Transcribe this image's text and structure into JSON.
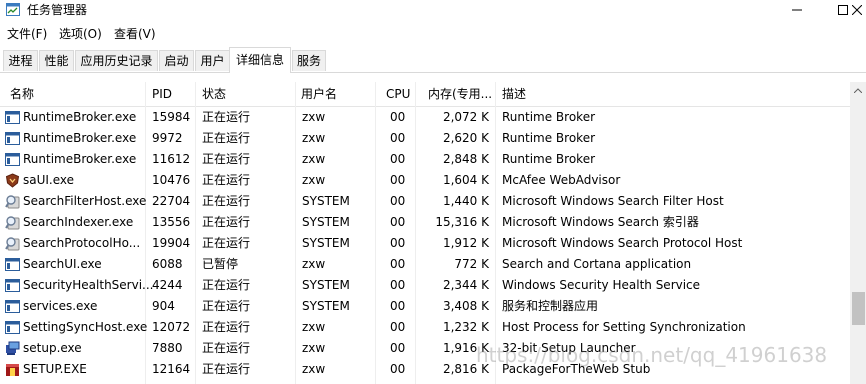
{
  "window": {
    "title": "任务管理器"
  },
  "menu": [
    "文件(F)",
    "选项(O)",
    "查看(V)"
  ],
  "tabs": [
    "进程",
    "性能",
    "应用历史记录",
    "启动",
    "用户",
    "详细信息",
    "服务"
  ],
  "active_tab": "详细信息",
  "columns": {
    "name": "名称",
    "pid": "PID",
    "status": "状态",
    "user": "用户名",
    "cpu": "CPU",
    "mem": "内存(专用...",
    "desc": "描述"
  },
  "rows": [
    {
      "icon": "window-app-icon",
      "name": "RuntimeBroker.exe",
      "pid": "15984",
      "status": "正在运行",
      "user": "zxw",
      "cpu": "00",
      "mem": "2,072 K",
      "desc": "Runtime Broker"
    },
    {
      "icon": "window-app-icon",
      "name": "RuntimeBroker.exe",
      "pid": "9972",
      "status": "正在运行",
      "user": "zxw",
      "cpu": "00",
      "mem": "2,620 K",
      "desc": "Runtime Broker"
    },
    {
      "icon": "window-app-icon",
      "name": "RuntimeBroker.exe",
      "pid": "11612",
      "status": "正在运行",
      "user": "zxw",
      "cpu": "00",
      "mem": "2,848 K",
      "desc": "Runtime Broker"
    },
    {
      "icon": "mcafee-shield-icon",
      "name": "saUI.exe",
      "pid": "10476",
      "status": "正在运行",
      "user": "zxw",
      "cpu": "00",
      "mem": "1,604 K",
      "desc": "McAfee WebAdvisor"
    },
    {
      "icon": "search-indexer-icon",
      "name": "SearchFilterHost.exe",
      "pid": "22704",
      "status": "正在运行",
      "user": "SYSTEM",
      "cpu": "00",
      "mem": "1,440 K",
      "desc": "Microsoft Windows Search Filter Host"
    },
    {
      "icon": "search-indexer-icon",
      "name": "SearchIndexer.exe",
      "pid": "13556",
      "status": "正在运行",
      "user": "SYSTEM",
      "cpu": "00",
      "mem": "15,316 K",
      "desc": "Microsoft Windows Search 索引器"
    },
    {
      "icon": "search-indexer-icon",
      "name": "SearchProtocolHo...",
      "pid": "19904",
      "status": "正在运行",
      "user": "SYSTEM",
      "cpu": "00",
      "mem": "1,912 K",
      "desc": "Microsoft Windows Search Protocol Host"
    },
    {
      "icon": "window-app-icon",
      "name": "SearchUI.exe",
      "pid": "6088",
      "status": "已暂停",
      "user": "zxw",
      "cpu": "00",
      "mem": "772 K",
      "desc": "Search and Cortana application"
    },
    {
      "icon": "window-app-icon",
      "name": "SecurityHealthServi...",
      "pid": "4244",
      "status": "正在运行",
      "user": "SYSTEM",
      "cpu": "00",
      "mem": "2,344 K",
      "desc": "Windows Security Health Service"
    },
    {
      "icon": "window-app-icon",
      "name": "services.exe",
      "pid": "904",
      "status": "正在运行",
      "user": "SYSTEM",
      "cpu": "00",
      "mem": "3,408 K",
      "desc": "服务和控制器应用"
    },
    {
      "icon": "window-app-icon",
      "name": "SettingSyncHost.exe",
      "pid": "12072",
      "status": "正在运行",
      "user": "zxw",
      "cpu": "00",
      "mem": "1,232 K",
      "desc": "Host Process for Setting Synchronization"
    },
    {
      "icon": "setup-installer-icon",
      "name": "setup.exe",
      "pid": "7880",
      "status": "正在运行",
      "user": "zxw",
      "cpu": "00",
      "mem": "1,916 K",
      "desc": "32-bit Setup Launcher"
    },
    {
      "icon": "setup-package-icon",
      "name": "SETUP.EXE",
      "pid": "12164",
      "status": "正在运行",
      "user": "zxw",
      "cpu": "00",
      "mem": "2,816 K",
      "desc": "PackageForTheWeb Stub"
    }
  ],
  "watermark": "https://blog.csdn.net/qq_41961638",
  "colors": {
    "accent": "#0067c0",
    "border": "#d9d9d9"
  }
}
